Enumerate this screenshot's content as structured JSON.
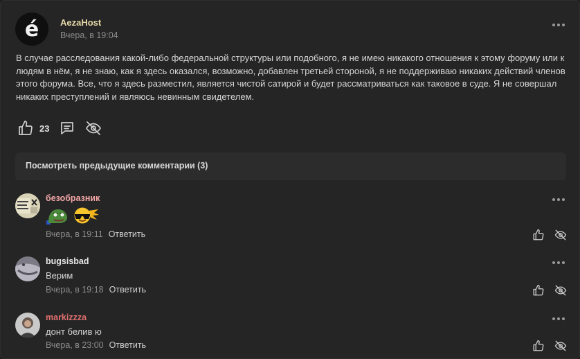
{
  "post": {
    "author": "AezaHost",
    "avatar_letter": "é",
    "time": "Вчера, в 19:04",
    "body": "В случае расследования какой-либо федеральной структуры или подобного, я не имею никакого отношения к этому форуму или к людям в нём, я не знаю, как я здесь оказался, возможно, добавлен третьей стороной, я не поддерживаю никаких действий членов этого форума. Все, что я здесь разместил, является чистой сатирой и будет рассматриваться как таковое в суде. Я не совершал никаких преступлений и являюсь невинным свидетелем.",
    "likes": "23",
    "icons": [
      "like-icon",
      "comment-icon",
      "hide-icon",
      "more-icon"
    ]
  },
  "prev_comments_label": "Посмотреть предыдущие комментарии (3)",
  "comments": [
    {
      "author": "безобразник",
      "author_color": "#f3a6a6",
      "text": "",
      "emojis": [
        "pepe-emoji",
        "cool-sun-emoji"
      ],
      "time": "Вчера, в 19:11",
      "reply": "Ответить",
      "avatar_text": "ROF\nX"
    },
    {
      "author": "bugsisbad",
      "author_color": "#e8e8e8",
      "text": "Верим",
      "time": "Вчера, в 19:18",
      "reply": "Ответить"
    },
    {
      "author": "markizzza",
      "author_color": "#e07070",
      "text": "донт белив ю",
      "time": "Вчера, в 23:00",
      "reply": "Ответить"
    }
  ],
  "colors": {
    "background": "#252525",
    "muted": "#8c8c8c",
    "post_author": "#e8d9a8"
  }
}
